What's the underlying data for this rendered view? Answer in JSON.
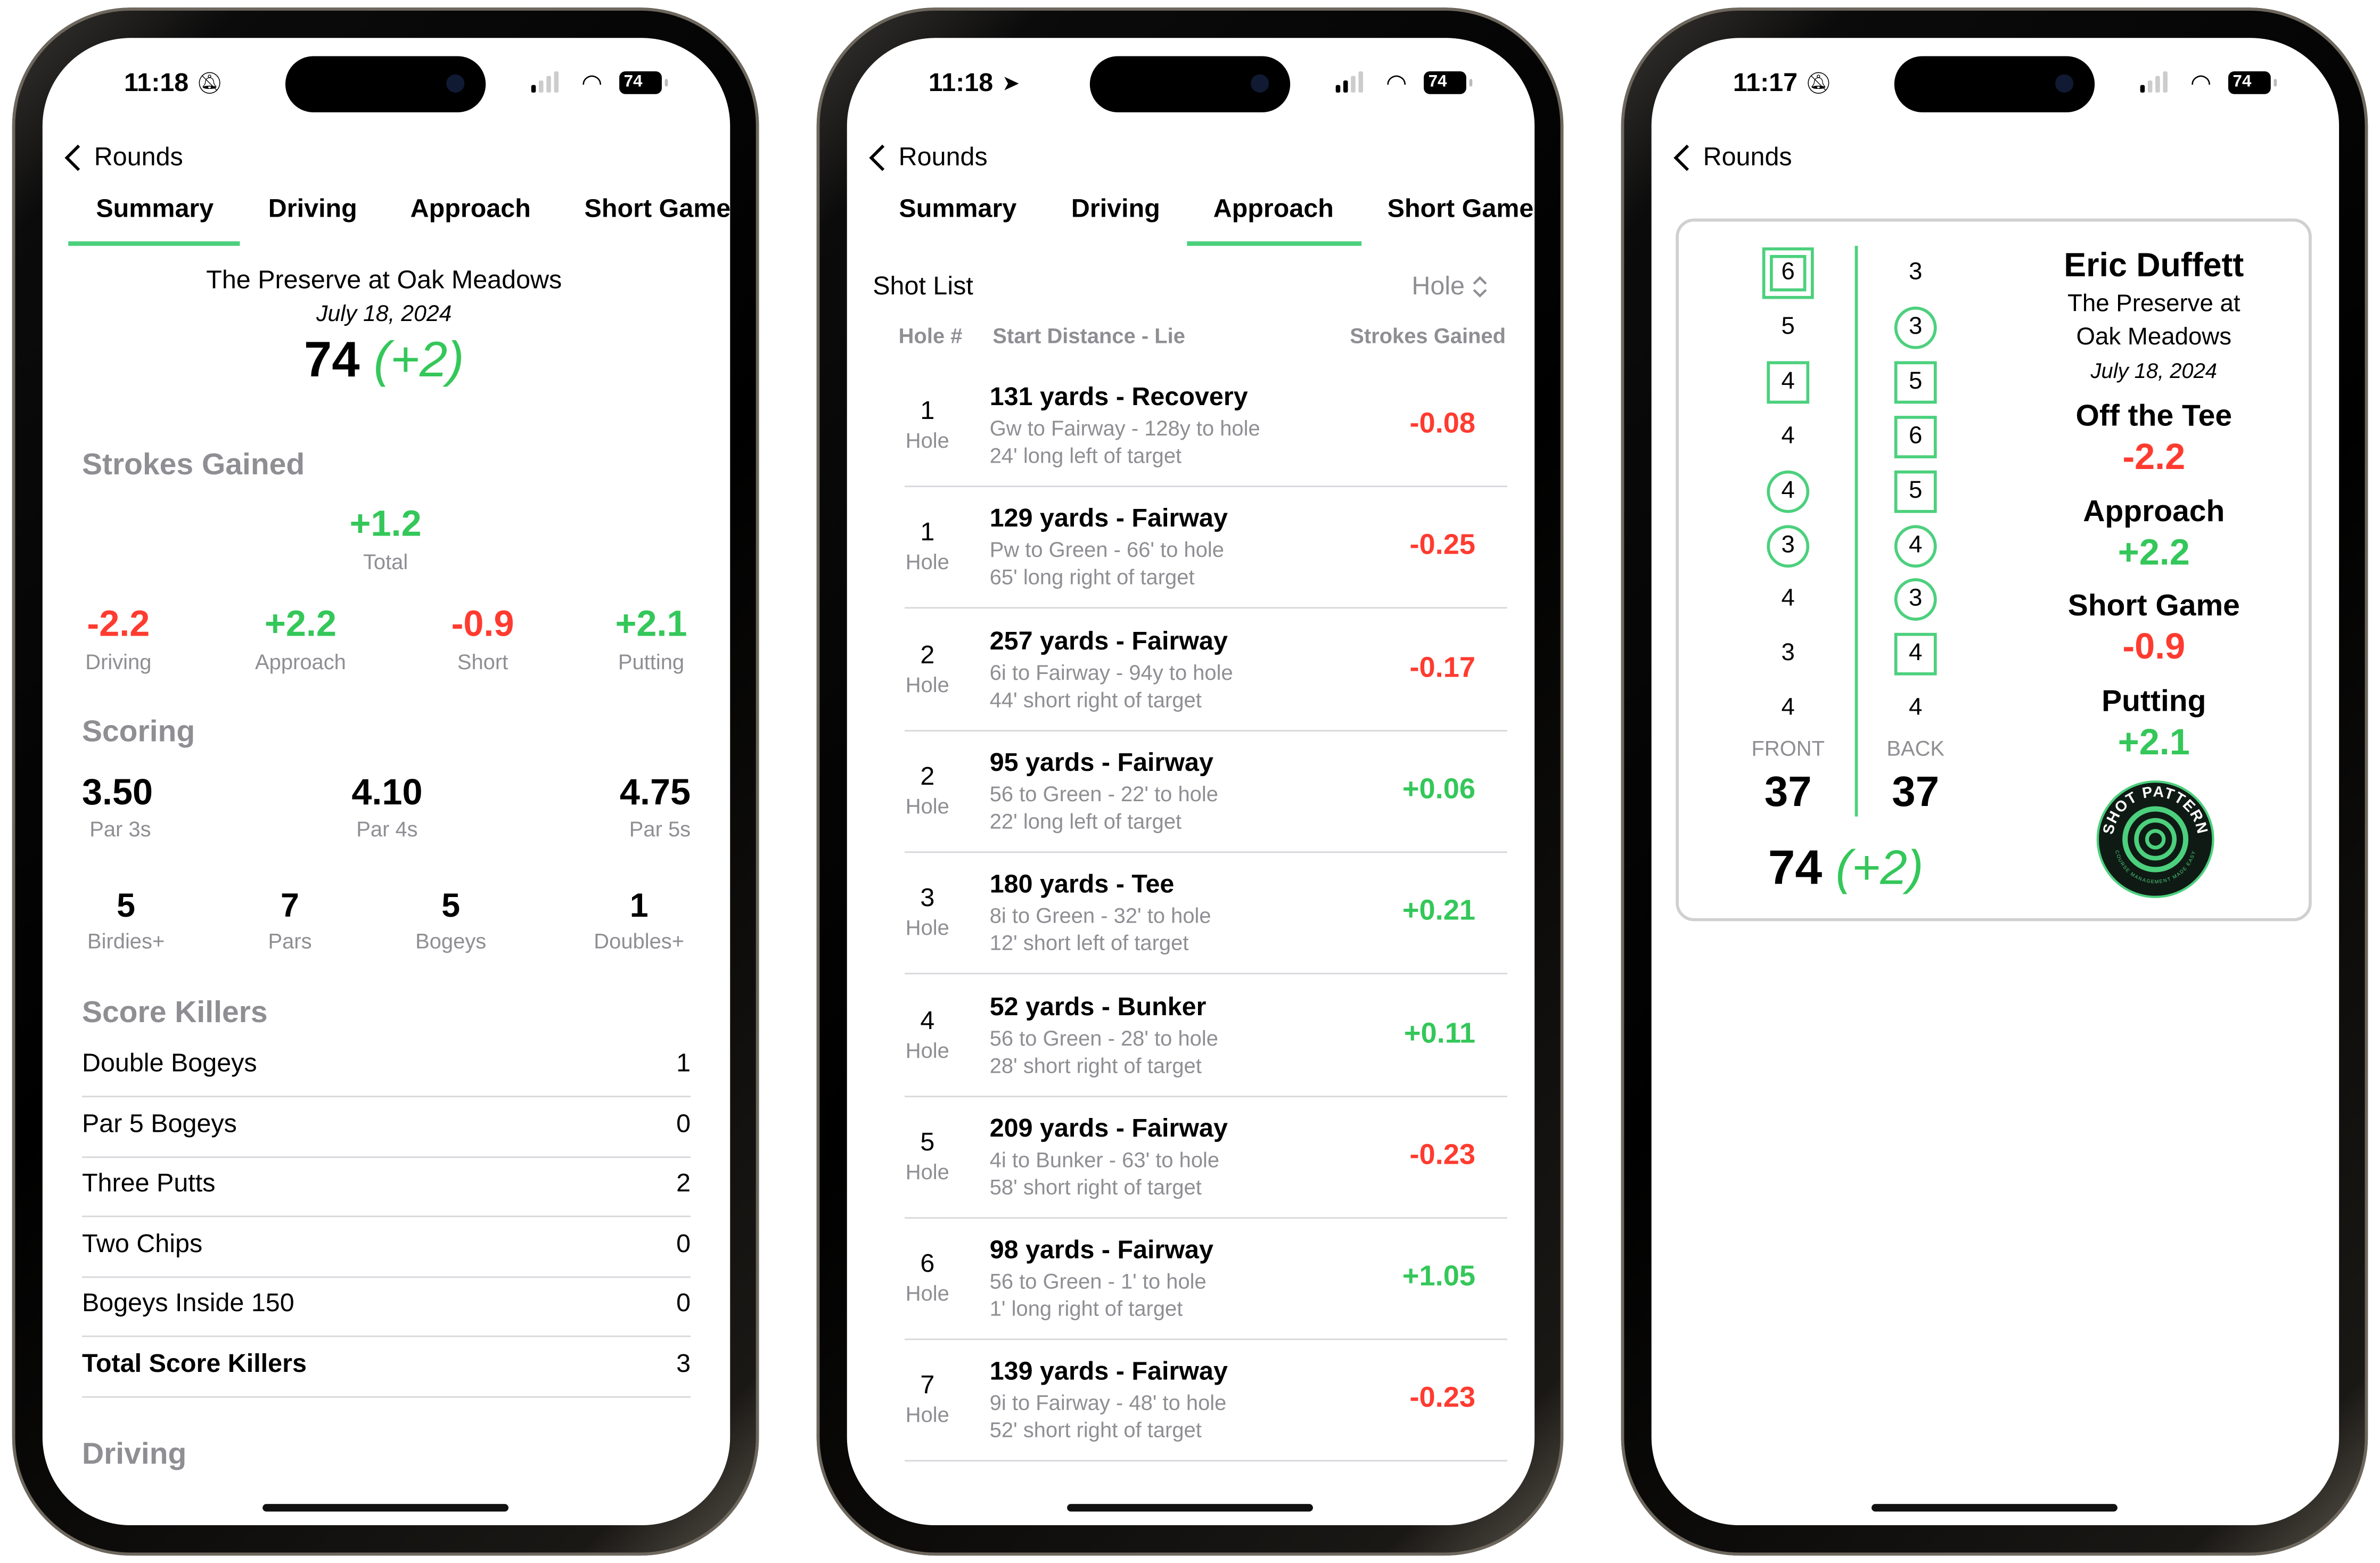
{
  "colors": {
    "accent": "#4cd07d",
    "positive": "#34c759",
    "negative": "#ff3b30",
    "secondary": "#8e8e93"
  },
  "status": {
    "battery": "74",
    "phone1_time": "11:18",
    "phone2_time": "11:18",
    "phone3_time": "11:17"
  },
  "nav": {
    "back_label": "Rounds"
  },
  "tabs": [
    "Summary",
    "Driving",
    "Approach",
    "Short Game"
  ],
  "summary": {
    "course": "The Preserve at Oak Meadows",
    "date": "July 18, 2024",
    "score": "74",
    "to_par": "(+2)",
    "strokes_gained": {
      "title": "Strokes Gained",
      "total_value": "+1.2",
      "total_label": "Total",
      "items": [
        {
          "value": "-2.2",
          "label": "Driving",
          "sign": "neg"
        },
        {
          "value": "+2.2",
          "label": "Approach",
          "sign": "pos"
        },
        {
          "value": "-0.9",
          "label": "Short",
          "sign": "neg"
        },
        {
          "value": "+2.1",
          "label": "Putting",
          "sign": "pos"
        }
      ]
    },
    "scoring": {
      "title": "Scoring",
      "averages": [
        {
          "value": "3.50",
          "label": "Par 3s"
        },
        {
          "value": "4.10",
          "label": "Par 4s"
        },
        {
          "value": "4.75",
          "label": "Par 5s"
        }
      ],
      "counts": [
        {
          "value": "5",
          "label": "Birdies+"
        },
        {
          "value": "7",
          "label": "Pars"
        },
        {
          "value": "5",
          "label": "Bogeys"
        },
        {
          "value": "1",
          "label": "Doubles+"
        }
      ]
    },
    "score_killers": {
      "title": "Score Killers",
      "rows": [
        {
          "label": "Double Bogeys",
          "value": "1"
        },
        {
          "label": "Par 5 Bogeys",
          "value": "0"
        },
        {
          "label": "Three Putts",
          "value": "2"
        },
        {
          "label": "Two Chips",
          "value": "0"
        },
        {
          "label": "Bogeys Inside 150",
          "value": "0"
        },
        {
          "label": "Total Score Killers",
          "value": "3",
          "bold": true
        }
      ]
    },
    "next_section": "Driving"
  },
  "approach": {
    "title": "Shot List",
    "sort_label": "Hole",
    "headers": {
      "hole": "Hole #",
      "distance": "Start Distance - Lie",
      "sg": "Strokes Gained"
    },
    "hole_label": "Hole",
    "shots": [
      {
        "hole": "1",
        "title": "131 yards - Recovery",
        "line1": "Gw to Fairway - 128y to hole",
        "line2": "24' long left of target",
        "sg": "-0.08"
      },
      {
        "hole": "1",
        "title": "129 yards - Fairway",
        "line1": "Pw to Green - 66' to hole",
        "line2": "65' long right of target",
        "sg": "-0.25"
      },
      {
        "hole": "2",
        "title": "257 yards - Fairway",
        "line1": "6i to Fairway - 94y to hole",
        "line2": "44' short right of target",
        "sg": "-0.17"
      },
      {
        "hole": "2",
        "title": "95 yards - Fairway",
        "line1": "56 to Green - 22' to hole",
        "line2": "22' long left of target",
        "sg": "+0.06"
      },
      {
        "hole": "3",
        "title": "180 yards - Tee",
        "line1": "8i to Green - 32' to hole",
        "line2": "12' short left of target",
        "sg": "+0.21"
      },
      {
        "hole": "4",
        "title": "52 yards - Bunker",
        "line1": "56 to Green - 28' to hole",
        "line2": "28' short right of target",
        "sg": "+0.11"
      },
      {
        "hole": "5",
        "title": "209 yards - Fairway",
        "line1": "4i to Bunker - 63' to hole",
        "line2": "58' short right of target",
        "sg": "-0.23"
      },
      {
        "hole": "6",
        "title": "98 yards - Fairway",
        "line1": "56 to Green - 1' to hole",
        "line2": "1' long right of target",
        "sg": "+1.05"
      },
      {
        "hole": "7",
        "title": "139 yards - Fairway",
        "line1": "9i to Fairway - 48' to hole",
        "line2": "52' short right of target",
        "sg": "-0.23"
      }
    ]
  },
  "scorecard": {
    "front": [
      {
        "s": "6",
        "m": "double"
      },
      {
        "s": "5",
        "m": ""
      },
      {
        "s": "4",
        "m": "box"
      },
      {
        "s": "4",
        "m": ""
      },
      {
        "s": "4",
        "m": "circle"
      },
      {
        "s": "3",
        "m": "circle"
      },
      {
        "s": "4",
        "m": ""
      },
      {
        "s": "3",
        "m": ""
      },
      {
        "s": "4",
        "m": ""
      }
    ],
    "back": [
      {
        "s": "3",
        "m": ""
      },
      {
        "s": "3",
        "m": "circle"
      },
      {
        "s": "5",
        "m": "box"
      },
      {
        "s": "6",
        "m": "box"
      },
      {
        "s": "5",
        "m": "box"
      },
      {
        "s": "4",
        "m": "circle"
      },
      {
        "s": "3",
        "m": "circle"
      },
      {
        "s": "4",
        "m": "box"
      },
      {
        "s": "4",
        "m": ""
      }
    ],
    "front_label": "FRONT",
    "front_total": "37",
    "back_label": "BACK",
    "back_total": "37",
    "total": "74",
    "to_par": "(+2)",
    "player": "Eric Duffett",
    "course_line1": "The Preserve at",
    "course_line2": "Oak Meadows",
    "date": "July 18, 2024",
    "categories": [
      {
        "label": "Off the Tee",
        "value": "-2.2",
        "sign": "neg"
      },
      {
        "label": "Approach",
        "value": "+2.2",
        "sign": "pos"
      },
      {
        "label": "Short Game",
        "value": "-0.9",
        "sign": "neg"
      },
      {
        "label": "Putting",
        "value": "+2.1",
        "sign": "pos"
      }
    ],
    "logo_text": "SHOT PATTERN",
    "logo_subtext": "COURSE MANAGEMENT MADE EASY"
  }
}
